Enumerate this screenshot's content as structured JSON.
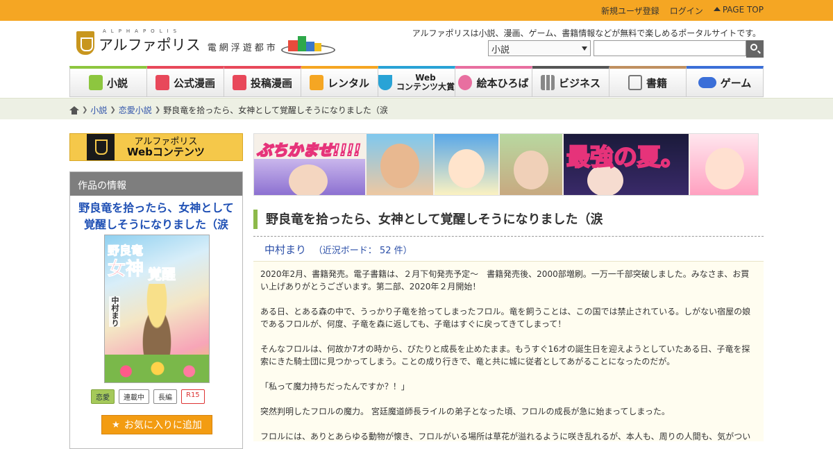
{
  "topbar": {
    "register": "新規ユーザ登録",
    "login": "ログイン",
    "page_top": "PAGE TOP"
  },
  "header": {
    "logo_sub": "ALPHAPOLIS",
    "logo_main": "アルファポリス",
    "logo_city": "電網浮遊都市",
    "tagline": "アルファポリスは小説、漫画、ゲーム、書籍情報などが無料で楽しめるポータルサイトです。",
    "search_category": "小説"
  },
  "nav": [
    {
      "label": "小説",
      "color": "#8dc63f"
    },
    {
      "label": "公式漫画",
      "color": "#e8485a"
    },
    {
      "label": "投稿漫画",
      "color": "#e8485a"
    },
    {
      "label": "レンタル",
      "color": "#f5a623"
    },
    {
      "label_line1": "Web",
      "label_line2": "コンテンツ大賞",
      "color": "#29a3d6"
    },
    {
      "label": "絵本ひろば",
      "color": "#e86fa0"
    },
    {
      "label": "ビジネス",
      "color": "#555555"
    },
    {
      "label": "書籍",
      "color": "#c09060"
    },
    {
      "label": "ゲーム",
      "color": "#3b6fd8"
    }
  ],
  "breadcrumb": {
    "item1": "小説",
    "item2": "恋愛小説",
    "current": "野良竜を拾ったら、女神として覚醒しそうになりました（涙"
  },
  "sidebar": {
    "webcontents_line1": "アルファポリス",
    "webcontents_line2": "Webコンテンツ",
    "info_heading": "作品の情報",
    "work_title": "野良竜を拾ったら、女神として覚醒しそうになりました（涙",
    "cover": {
      "title_a": "野良竜",
      "title_b": "女神",
      "title_c": "覚醒",
      "author": "中村まり"
    },
    "tags": [
      "恋愛",
      "連載中",
      "長編",
      "R15"
    ],
    "favorite_button": "お気に入りに追加"
  },
  "banner": {
    "text1": "ぶちかませ!!!!",
    "text2": "最強の夏。"
  },
  "main": {
    "title": "野良竜を拾ったら、女神として覚醒しそうになりました（涙",
    "author": "中村まり",
    "board": "（近況ボード： 52 件）",
    "summary": [
      "2020年2月、書籍発売。電子書籍は、２月下旬発売予定～　書籍発売後、2000部増刷。一万一千部突破しました。みなさま、お買い上げありがとうございます。第二部、2020年２月開始！",
      "ある日、とある森の中で、うっかり子竜を拾ってしまったフロル。竜を飼うことは、この国では禁止されている。しがない宿屋の娘であるフロルが、何度、子竜を森に返しても、子竜はすぐに戻ってきてしまって！",
      "そんなフロルは、何故か7才の時から、ぴたりと成長を止めたまま。もうすぐ16才の誕生日を迎えようとしていたある日、子竜を探索にきた騎士団に見つかってしまう。ことの成り行きで、竜と共に城に従者としてあがることになったのだが。",
      "「私って魔力持ちだったんですか？！」",
      "突然判明したフロルの魔力。 宮廷魔道師長ライルの弟子となった頃、フロルの成長が急に始まってしまった。",
      "フロルには、ありとあらゆる動物が懐き、フロルがいる場所は草花が溢れるように咲き乱れるが、本人も、周りの人間も、気がつい"
    ]
  }
}
